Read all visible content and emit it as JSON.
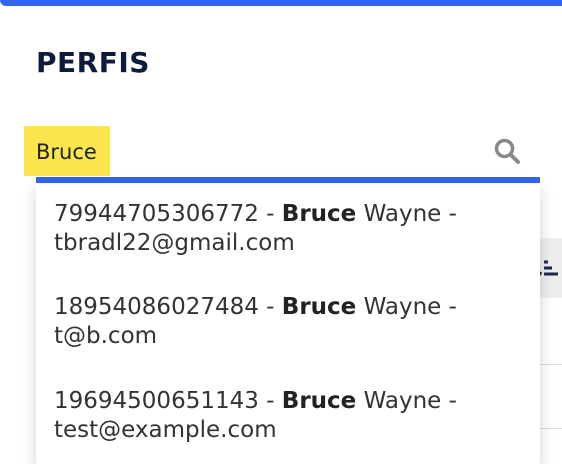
{
  "page": {
    "title": "PERFIS"
  },
  "search": {
    "value": "Bruce"
  },
  "autocomplete": {
    "options": [
      {
        "id": "79944705306772",
        "sep1": " - ",
        "match": "Bruce",
        "rest": " Wayne -",
        "email": "tbradl22@gmail.com"
      },
      {
        "id": "18954086027484",
        "sep1": " - ",
        "match": "Bruce",
        "rest": " Wayne -",
        "email": "t@b.com"
      },
      {
        "id": "19694500651143",
        "sep1": " - ",
        "match": "Bruce",
        "rest": " Wayne -",
        "email": "test@example.com"
      }
    ]
  },
  "colors": {
    "accent": "#3366ee",
    "highlight": "#fbe64d",
    "title": "#0d1b3e"
  },
  "icons": {
    "search": "search-icon",
    "sort": "sort-icon"
  }
}
